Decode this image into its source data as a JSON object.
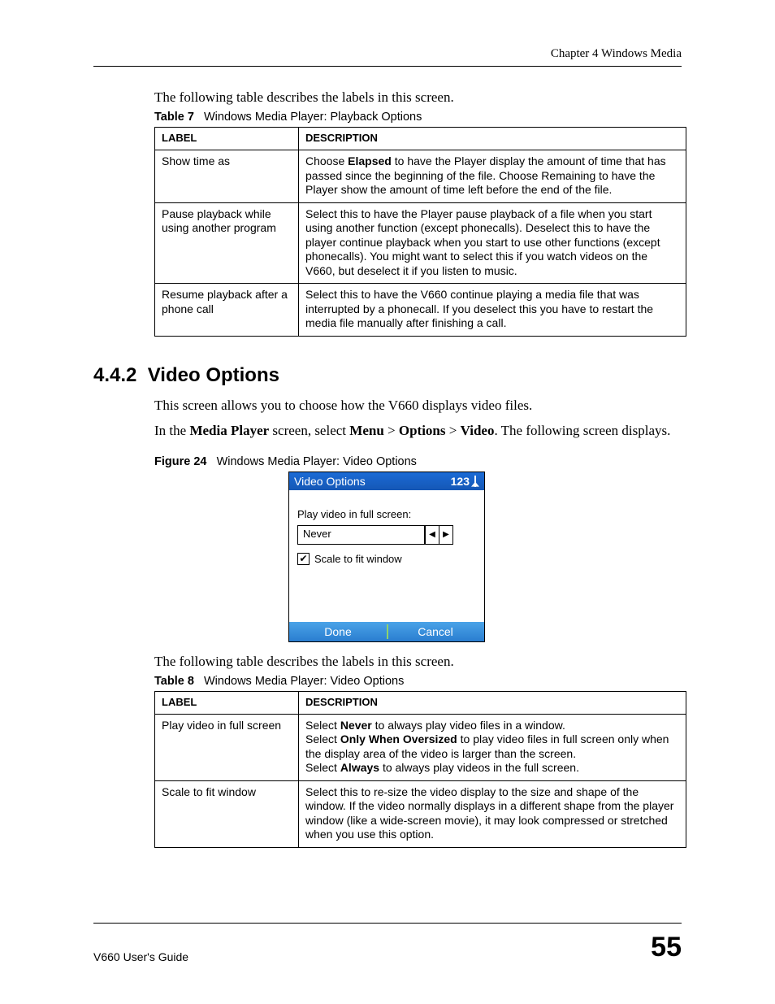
{
  "header": {
    "chapter": "Chapter 4 Windows Media"
  },
  "intro1": "The following table describes the labels in this screen.",
  "table7": {
    "caption_label": "Table 7",
    "caption_text": "Windows Media Player: Playback Options",
    "head_label": "Label",
    "head_desc": "Description",
    "rows": [
      {
        "label": "Show time as",
        "desc_pre": "Choose ",
        "desc_bold": "Elapsed",
        "desc_post": " to have the Player display the amount of time that has passed since the beginning of the file. Choose Remaining to have the Player show the amount of time left before the end of the file."
      },
      {
        "label": "Pause playback while using another program",
        "desc": "Select this to have the Player pause playback of a file when you start using another function (except phonecalls). Deselect this to have the player continue playback when you start to use other functions (except phonecalls). You might want to select this if you watch videos on the V660, but deselect it if you listen to music."
      },
      {
        "label": "Resume playback after a phone call",
        "desc": "Select this to have the V660 continue playing a media file that was interrupted by a phonecall. If you deselect this you have to restart the media file manually after finishing a call."
      }
    ]
  },
  "section": {
    "num": "4.4.2",
    "title": "Video Options"
  },
  "body1": "This screen allows you to choose how the V660 displays video files.",
  "body2": {
    "pre": "In the ",
    "b1": "Media Player",
    "mid1": " screen, select ",
    "b2": "Menu",
    "gt1": " > ",
    "b3": "Options",
    "gt2": " > ",
    "b4": "Video",
    "post": ". The following screen displays."
  },
  "figure": {
    "caption_label": "Figure 24",
    "caption_text": "Windows Media Player: Video Options",
    "title": "Video Options",
    "indicator": "123",
    "label_fullscreen": "Play video in full screen:",
    "spinner_value": "Never",
    "checkbox_label": "Scale to fit window",
    "btn_done": "Done",
    "btn_cancel": "Cancel"
  },
  "intro2": "The following table describes the labels in this screen.",
  "table8": {
    "caption_label": "Table 8",
    "caption_text": "Windows Media Player: Video Options",
    "head_label": "Label",
    "head_desc": "Description",
    "rows": [
      {
        "label": "Play video in full screen",
        "l1_pre": "Select ",
        "l1_b": "Never",
        "l1_post": " to always play video files in a window.",
        "l2_pre": "Select ",
        "l2_b": "Only When Oversized",
        "l2_post": " to play video files in full screen only when the display area of the video is larger than the screen.",
        "l3_pre": "Select ",
        "l3_b": "Always",
        "l3_post": " to always play videos in the full screen."
      },
      {
        "label": "Scale to fit window",
        "desc": "Select this to re-size the video display to the size and shape of the window. If the video normally displays in a different shape from the player window (like a wide-screen movie), it may look compressed or stretched when you use this option."
      }
    ]
  },
  "footer": {
    "guide": "V660 User's Guide",
    "page": "55"
  }
}
